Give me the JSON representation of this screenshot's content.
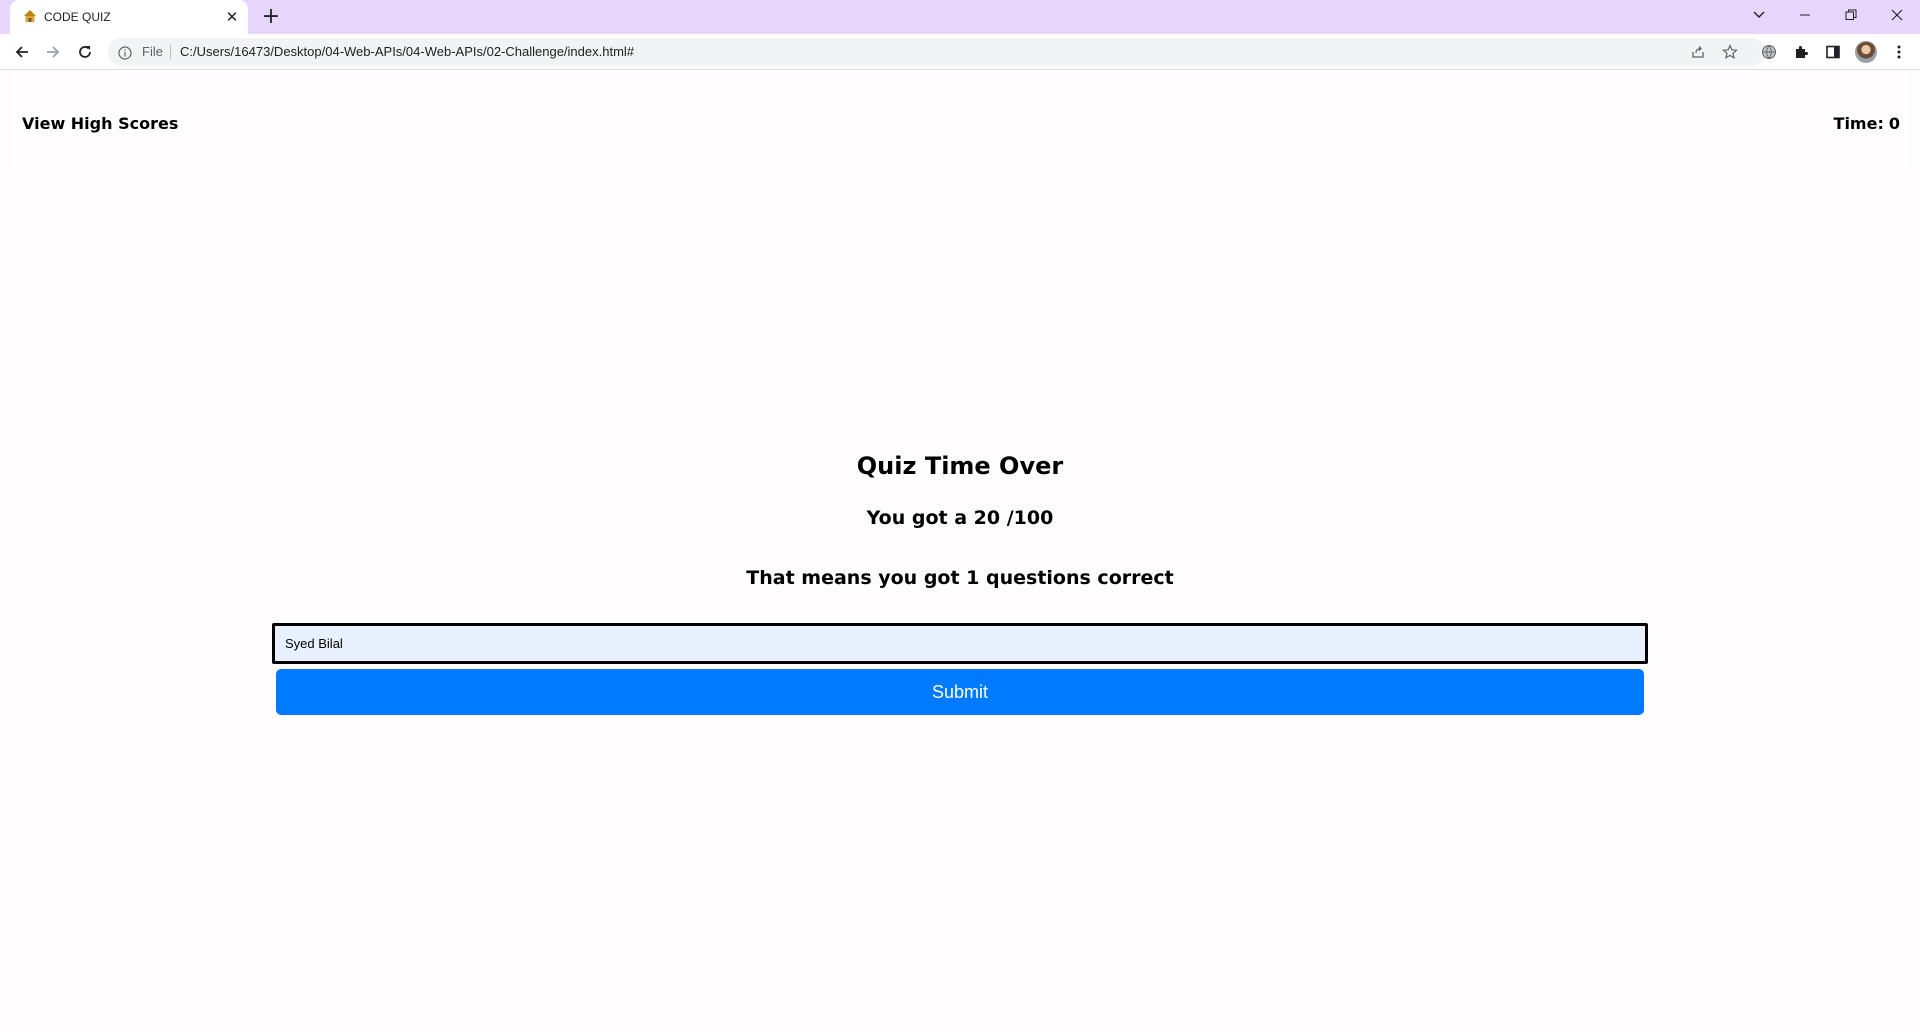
{
  "browser": {
    "tab": {
      "title": "CODE QUIZ"
    },
    "address_bar": {
      "scheme_label": "File",
      "url": "C:/Users/16473/Desktop/04-Web-APIs/04-Web-APIs/02-Challenge/index.html#"
    }
  },
  "header": {
    "high_scores_link": "View High Scores",
    "timer_label": "Time:",
    "timer_value": "0"
  },
  "result": {
    "title": "Quiz Time Over",
    "score_text": "You got a 20 /100",
    "correct_text": "That means you got 1 questions correct",
    "initials_value": "Syed Bilal",
    "submit_label": "Submit"
  }
}
